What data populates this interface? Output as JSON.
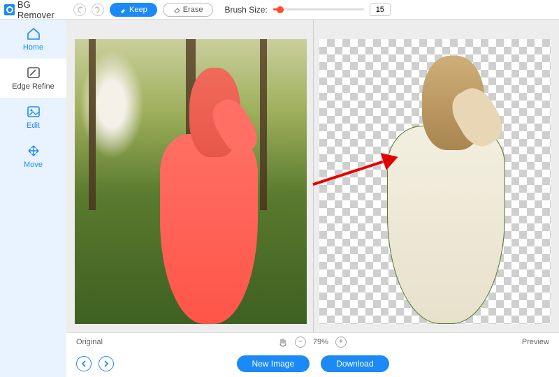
{
  "app": {
    "title": "BG Remover"
  },
  "sidebar": {
    "items": [
      {
        "label": "Home"
      },
      {
        "label": "Edge Refine"
      },
      {
        "label": "Edit"
      },
      {
        "label": "Move"
      }
    ],
    "activeIndex": 1
  },
  "toolbar": {
    "keep_label": "Keep",
    "erase_label": "Erase",
    "brush_label": "Brush Size:",
    "brush_value": "15"
  },
  "status": {
    "original_label": "Original",
    "preview_label": "Preview",
    "zoom_text": "79%"
  },
  "bottom": {
    "new_image_label": "New Image",
    "download_label": "Download"
  }
}
